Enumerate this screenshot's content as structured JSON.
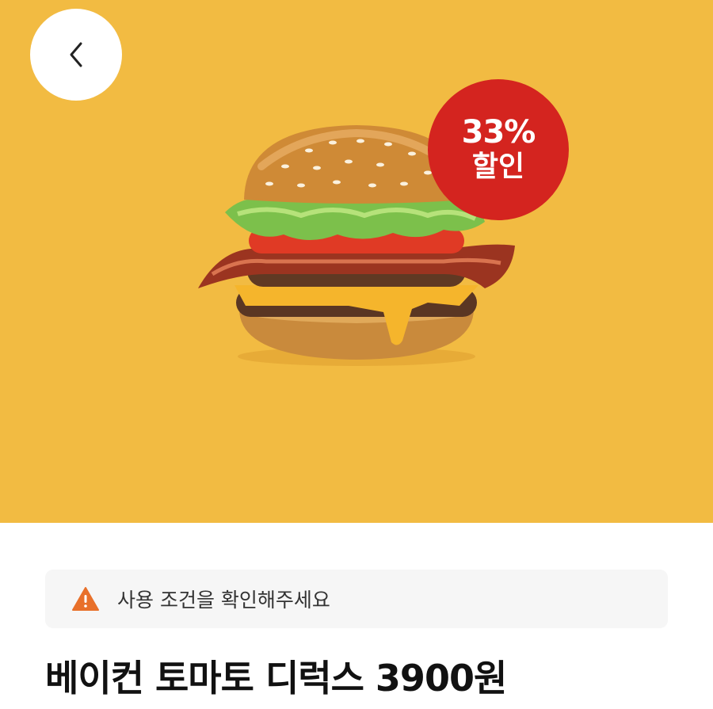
{
  "colors": {
    "hero_background": "#f2bb42",
    "badge_background": "#d4241f",
    "notice_background": "#f6f6f6",
    "warning_icon": "#e8702a"
  },
  "header": {
    "back_icon": "chevron-left-icon"
  },
  "product": {
    "image_icon": "burger-image",
    "discount_badge": {
      "percent": "33%",
      "text": "할인"
    },
    "notice": {
      "icon": "warning-triangle-icon",
      "text": "사용 조건을 확인해주세요"
    },
    "title": "베이컨 토마토 디럭스 3900원"
  }
}
